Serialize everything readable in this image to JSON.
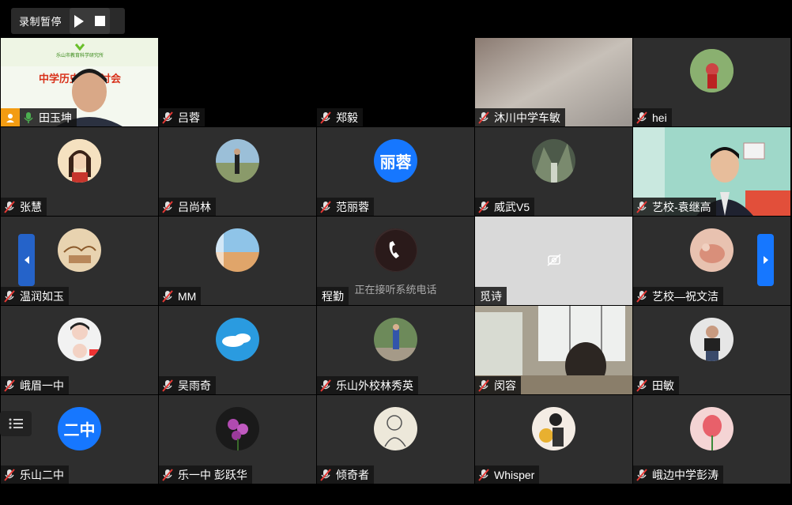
{
  "recording": {
    "label": "录制暂停",
    "play_icon": "play-icon",
    "stop_icon": "stop-icon"
  },
  "phone_status": "正在接听系统电话",
  "presenter_banner": {
    "org": "乐山市教育科学研究所",
    "title": "中学历史学研讨会"
  },
  "colors": {
    "accent": "#1677ff",
    "tile_bg": "#2e2e2e",
    "muted_mic": "#e0e0e0",
    "active_mic": "#4caf50"
  },
  "participants": [
    {
      "name": "田玉坤",
      "video": "presenter"
    },
    {
      "name": "吕蓉",
      "video": "dark"
    },
    {
      "name": "郑毅",
      "video": "dark"
    },
    {
      "name": "沐川中学车敏",
      "video": "blurred"
    },
    {
      "name": "hei",
      "video": "avatar"
    },
    {
      "name": "张慧",
      "video": "avatar"
    },
    {
      "name": "吕尚林",
      "video": "avatar"
    },
    {
      "name": "范丽蓉",
      "avatar_text": "丽蓉"
    },
    {
      "name": "威武V5",
      "video": "avatar"
    },
    {
      "name": "艺校-袁继高",
      "video": "camera"
    },
    {
      "name": "温润如玉",
      "video": "avatar"
    },
    {
      "name": "MM",
      "video": "avatar"
    },
    {
      "name": "程勤",
      "video": "phone"
    },
    {
      "name": "觅诗",
      "video": "camera-off"
    },
    {
      "name": "艺校—祝文洁",
      "video": "avatar"
    },
    {
      "name": "峨眉一中",
      "video": "avatar"
    },
    {
      "name": "吴雨奇",
      "video": "avatar"
    },
    {
      "name": "乐山外校林秀英",
      "video": "avatar"
    },
    {
      "name": "闵容",
      "video": "camera"
    },
    {
      "name": "田敏",
      "video": "avatar"
    },
    {
      "name": "乐山二中",
      "avatar_text": "二中"
    },
    {
      "name": "乐一中  彭跃华",
      "video": "avatar"
    },
    {
      "name": "倾奇者",
      "video": "avatar"
    },
    {
      "name": "Whisper",
      "video": "avatar"
    },
    {
      "name": "峨边中学彭涛",
      "video": "avatar"
    }
  ]
}
